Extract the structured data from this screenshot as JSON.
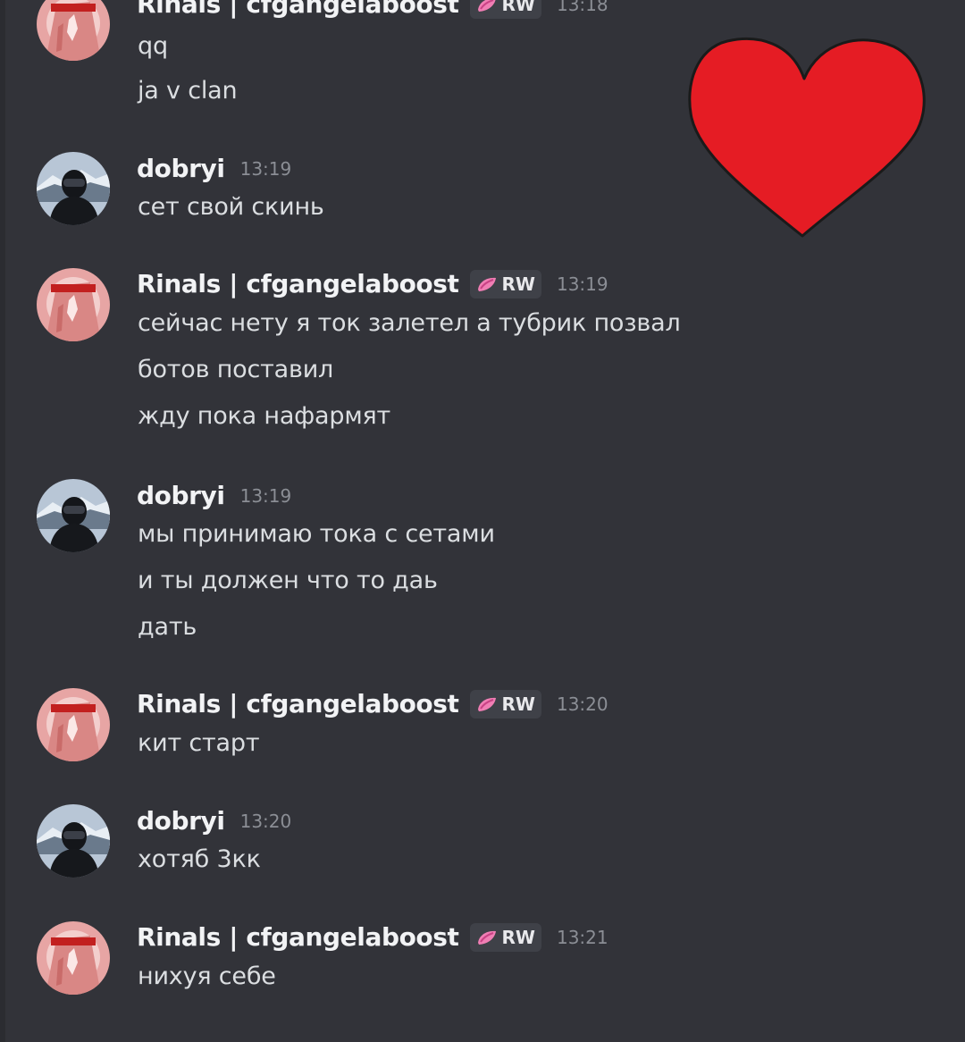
{
  "users": {
    "rinals": {
      "name": "Rinals | cfgangelaboost",
      "tag": "RW"
    },
    "dobryi": {
      "name": "dobryi"
    }
  },
  "top_cut": {
    "name": "Rinals | cfgangelaboost",
    "tag": "RW",
    "time": "13:18",
    "lines": [
      "qq",
      "ja v clan"
    ]
  },
  "messages": [
    {
      "time": "13:19",
      "lines": [
        "сет свой скинь"
      ]
    },
    {
      "time": "13:19",
      "lines": [
        "сейчас нету я ток залетел а тубрик позвал",
        "ботов поставил",
        "жду пока нафармят"
      ]
    },
    {
      "time": "13:19",
      "lines": [
        "мы принимаю тока с сетами",
        "и ты должен что то даь",
        "дать"
      ]
    },
    {
      "time": "13:20",
      "lines": [
        "кит старт"
      ]
    },
    {
      "time": "13:20",
      "lines": [
        "хотяб 3кк"
      ]
    },
    {
      "time": "13:21",
      "lines": [
        "нихуя себе"
      ]
    }
  ],
  "colors": {
    "background": "#323339",
    "username": "#f2f3f5",
    "message_text": "#dbdee1",
    "timestamp": "#8b8e95",
    "tag_bg": "#3f4148",
    "heart": "#e51c24"
  },
  "icons": {
    "tag_icon": "pink-gem-icon",
    "sticker": "red-heart-sticker"
  }
}
